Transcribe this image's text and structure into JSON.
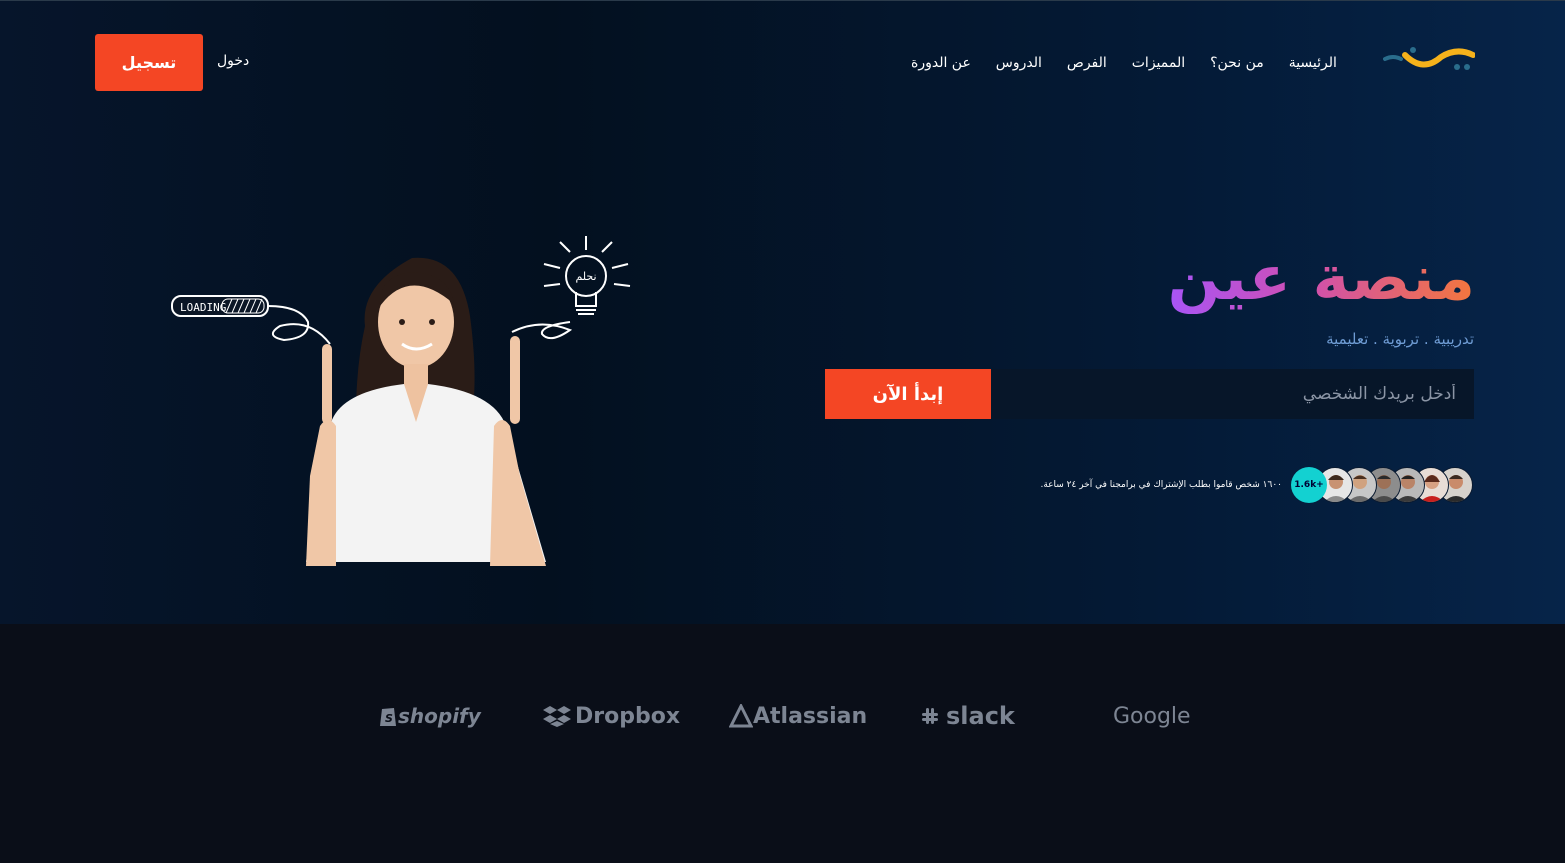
{
  "nav": {
    "items": [
      "الرئيسية",
      "من نحن؟",
      "المميزات",
      "الفرص",
      "الدروس",
      "عن الدورة"
    ],
    "login_label": "دخول",
    "signup_label": "تسجيل"
  },
  "hero": {
    "title": "منصة عين",
    "subtitle": "تدريبية . تربوية . تعليمية",
    "email_placeholder": "أدخل بريدك الشخصي",
    "start_button": "إبدأ الآن",
    "count_badge": "1.6k+",
    "social_proof": "١٦٠٠ شخص قاموا بطلب الإشتراك في برامجنا في آخر ٢٤ ساعة.",
    "loading_label": "LOADING",
    "bulb_label": "نحلم"
  },
  "partners": [
    "shopify",
    "Dropbox",
    "Atlassian",
    "slack",
    "Google"
  ],
  "colors": {
    "accent": "#f44624",
    "badge": "#13d1d1",
    "subtitle": "#6f9cd4"
  }
}
